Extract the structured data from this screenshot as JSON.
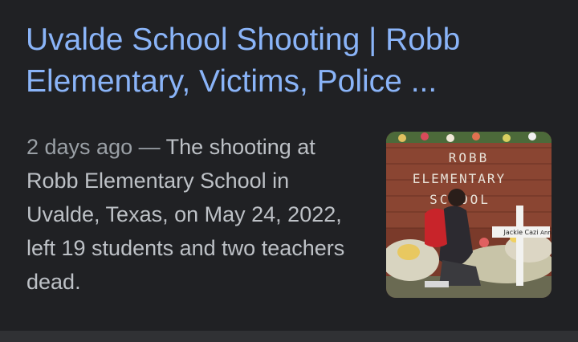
{
  "result": {
    "title_line1": "Uvalde School Shooting | Robb",
    "title_line2": "Elementary, Victims, Police ...",
    "date": "2 days ago",
    "separator": " — ",
    "snippet": "The shooting at Robb Elementary School in Uvalde, Texas, on May 24, 2022, left 19 students and two teachers dead.",
    "thumbnail": {
      "sign_line1": "ROBB",
      "sign_line2": "ELEMENTARY",
      "sign_line3": "SCHOOL",
      "cross_label": "Jackie Cazi",
      "cross_label_2": "Ann"
    }
  },
  "colors": {
    "background": "#202124",
    "title": "#8ab4f8",
    "snippet": "#bdc1c6",
    "date": "#9aa0a6"
  }
}
